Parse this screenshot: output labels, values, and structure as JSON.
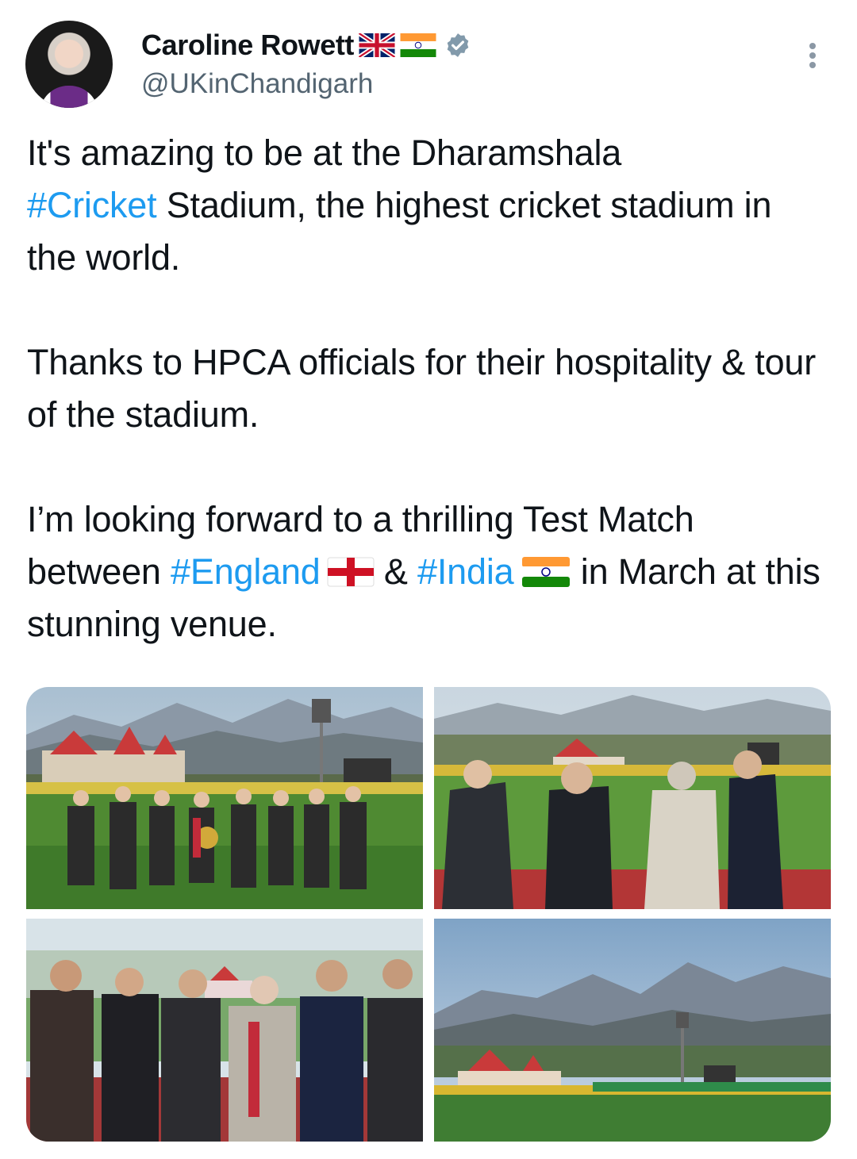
{
  "author": {
    "name": "Caroline Rowett",
    "handle": "@UKinChandigarh",
    "flags": [
      "uk-flag-icon",
      "india-flag-icon"
    ],
    "verified": true
  },
  "tweet": {
    "p1_a": "It's amazing to be at the Dharamshala",
    "p1_tag": "#Cricket",
    "p1_b": " Stadium, the highest cricket stadium in the world.",
    "p2": "Thanks to HPCA officials for their hospitality & tour of the stadium.",
    "p3_a": "I’m looking forward to a thrilling Test Match between ",
    "p3_tag1": "#England",
    "p3_mid": " & ",
    "p3_tag2": "#India",
    "p3_b": " in March at this stunning venue."
  },
  "colors": {
    "link": "#1d9bf0",
    "text": "#0f1419",
    "secondary": "#536471",
    "verified": "#829aab"
  },
  "media": {
    "count": 4
  }
}
